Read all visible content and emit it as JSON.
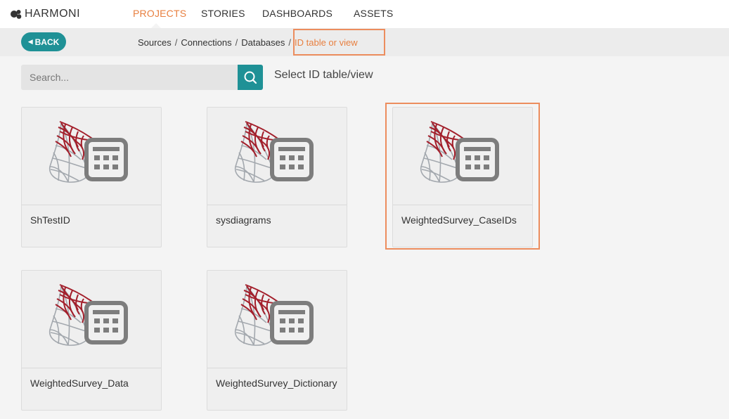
{
  "app": {
    "logo_text": "HARMONI"
  },
  "nav": {
    "items": [
      {
        "label": "PROJECTS",
        "active": true
      },
      {
        "label": "STORIES",
        "active": false
      },
      {
        "label": "DASHBOARDS",
        "active": false
      },
      {
        "label": "ASSETS",
        "active": false
      }
    ]
  },
  "breadcrumb": {
    "back_label": "BACK",
    "items": [
      "Sources",
      "Connections",
      "Databases"
    ],
    "separator": "/",
    "current": "ID table or view"
  },
  "search": {
    "placeholder": "Search..."
  },
  "page_title": "Select ID table/view",
  "tables": [
    {
      "name": "ShTestID",
      "icon": "sql-server-table-icon"
    },
    {
      "name": "sysdiagrams",
      "icon": "sql-server-table-icon"
    },
    {
      "name": "WeightedSurvey_CaseIDs",
      "icon": "sql-server-table-icon",
      "highlighted": true
    },
    {
      "name": "WeightedSurvey_Data",
      "icon": "sql-server-table-icon"
    },
    {
      "name": "WeightedSurvey_Dictionary",
      "icon": "sql-server-table-icon"
    }
  ],
  "colors": {
    "accent": "#e87f3f",
    "teal": "#1f9196",
    "highlight": "#ec8d5e",
    "sql_red": "#a31f2b",
    "sql_grey": "#9aa0a8",
    "table_icon": "#7d7d7d"
  }
}
